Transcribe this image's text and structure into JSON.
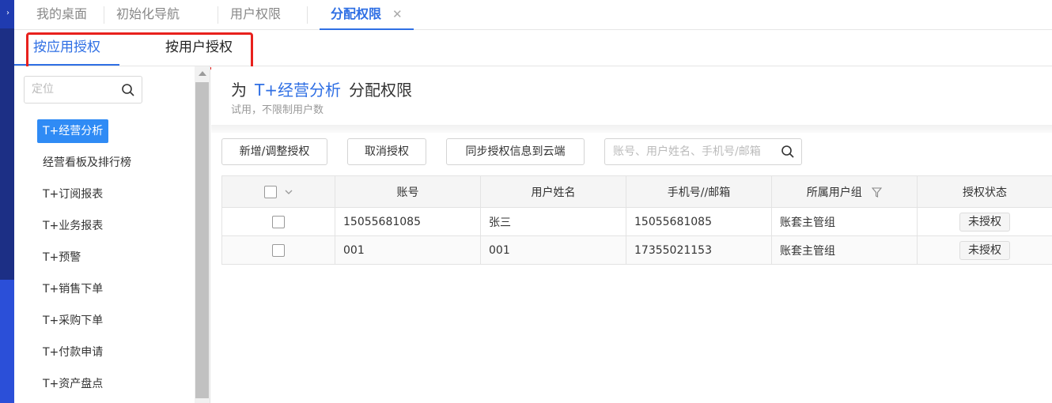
{
  "tabs": [
    {
      "label": "我的桌面",
      "active": false
    },
    {
      "label": "初始化导航",
      "active": false
    },
    {
      "label": "用户权限",
      "active": false
    },
    {
      "label": "分配权限",
      "active": true,
      "closable": true
    }
  ],
  "subtabs": [
    {
      "label": "按应用授权",
      "active": true
    },
    {
      "label": "按用户授权",
      "active": false
    }
  ],
  "sidebar": {
    "search_placeholder": "定位",
    "items": [
      {
        "label": "T+经营分析",
        "active": true
      },
      {
        "label": "经营看板及排行榜"
      },
      {
        "label": "T+订阅报表"
      },
      {
        "label": "T+业务报表"
      },
      {
        "label": "T+预警"
      },
      {
        "label": "T+销售下单"
      },
      {
        "label": "T+采购下单"
      },
      {
        "label": "T+付款申请"
      },
      {
        "label": "T+资产盘点"
      }
    ]
  },
  "header": {
    "prefix": "为",
    "app_name": "T+经营分析",
    "suffix": "分配权限",
    "subtitle": "试用，不限制用户数"
  },
  "toolbar": {
    "add_label": "新增/调整授权",
    "cancel_label": "取消授权",
    "sync_label": "同步授权信息到云端",
    "search_placeholder": "账号、用户姓名、手机号/邮箱"
  },
  "table": {
    "columns": [
      "账号",
      "用户姓名",
      "手机号//邮箱",
      "所属用户组",
      "授权状态"
    ],
    "rows": [
      {
        "account": "15055681085",
        "name": "张三",
        "phone": "15055681085",
        "group": "账套主管组",
        "status": "未授权"
      },
      {
        "account": "001",
        "name": "001",
        "phone": "17355021153",
        "group": "账套主管组",
        "status": "未授权"
      }
    ]
  },
  "colors": {
    "accent": "#2f6fe4",
    "highlight_box": "#e8211d",
    "sidebar_strip": "#2b4fd8"
  }
}
